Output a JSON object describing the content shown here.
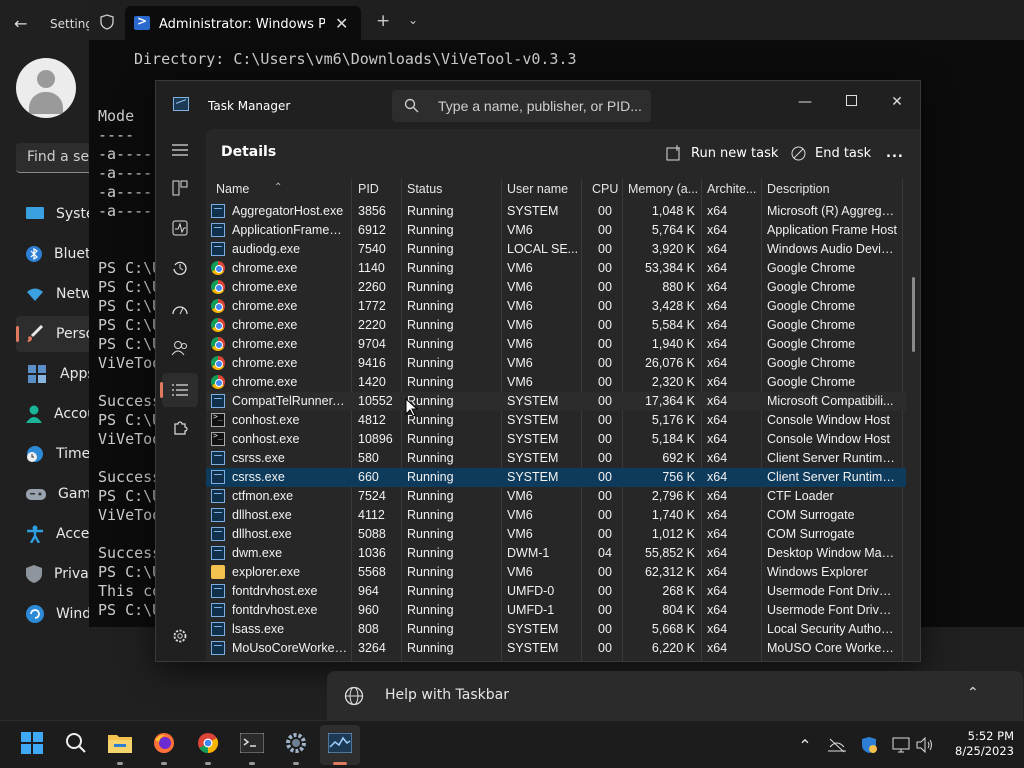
{
  "settings": {
    "title": "Settings",
    "find_placeholder": "Find a setting",
    "nav": [
      {
        "label": "System",
        "icon": "monitor-icon"
      },
      {
        "label": "Bluetooth & devices",
        "icon": "bluetooth-icon"
      },
      {
        "label": "Network & internet",
        "icon": "wifi-icon"
      },
      {
        "label": "Personalization",
        "icon": "brush-icon"
      },
      {
        "label": "Apps",
        "icon": "apps-icon"
      },
      {
        "label": "Accounts",
        "icon": "account-icon"
      },
      {
        "label": "Time & language",
        "icon": "clock-globe-icon"
      },
      {
        "label": "Gaming",
        "icon": "gamepad-icon"
      },
      {
        "label": "Accessibility",
        "icon": "accessibility-icon"
      },
      {
        "label": "Privacy & security",
        "icon": "shield-icon"
      },
      {
        "label": "Windows Update",
        "icon": "update-icon"
      }
    ]
  },
  "terminal": {
    "tab_title": "Administrator: Windows PowerShell",
    "lines": [
      "Directory: C:\\Users\\vm6\\Downloads\\ViVeTool-v0.3.3",
      "Mode",
      "----",
      "-a----",
      "-a----",
      "-a----",
      "-a----",
      "PS C:\\U",
      "PS C:\\U",
      "PS C:\\U",
      "PS C:\\U",
      "PS C:\\U",
      "ViVeToo",
      "Success",
      "PS C:\\U",
      "ViVeToo",
      "Success",
      "PS C:\\U",
      "ViVeToo",
      "Success",
      "PS C:\\U",
      "This co",
      "PS C:\\U"
    ]
  },
  "taskmgr": {
    "title": "Task Manager",
    "search_placeholder": "Type a name, publisher, or PID...",
    "page_title": "Details",
    "run_new_task": "Run new task",
    "end_task": "End task",
    "more": "...",
    "columns": [
      "Name",
      "PID",
      "Status",
      "User name",
      "CPU",
      "Memory (a...",
      "Archite...",
      "Description"
    ],
    "rows": [
      {
        "icon": "exe",
        "name": "AggregatorHost.exe",
        "pid": "3856",
        "status": "Running",
        "user": "SYSTEM",
        "cpu": "00",
        "mem": "1,048 K",
        "arch": "x64",
        "desc": "Microsoft (R) Aggrega..."
      },
      {
        "icon": "exe",
        "name": "ApplicationFrameHo...",
        "pid": "6912",
        "status": "Running",
        "user": "VM6",
        "cpu": "00",
        "mem": "5,764 K",
        "arch": "x64",
        "desc": "Application Frame Host"
      },
      {
        "icon": "exe",
        "name": "audiodg.exe",
        "pid": "7540",
        "status": "Running",
        "user": "LOCAL SE...",
        "cpu": "00",
        "mem": "3,920 K",
        "arch": "x64",
        "desc": "Windows Audio Devic..."
      },
      {
        "icon": "chrome",
        "name": "chrome.exe",
        "pid": "1140",
        "status": "Running",
        "user": "VM6",
        "cpu": "00",
        "mem": "53,384 K",
        "arch": "x64",
        "desc": "Google Chrome"
      },
      {
        "icon": "chrome",
        "name": "chrome.exe",
        "pid": "2260",
        "status": "Running",
        "user": "VM6",
        "cpu": "00",
        "mem": "880 K",
        "arch": "x64",
        "desc": "Google Chrome"
      },
      {
        "icon": "chrome",
        "name": "chrome.exe",
        "pid": "1772",
        "status": "Running",
        "user": "VM6",
        "cpu": "00",
        "mem": "3,428 K",
        "arch": "x64",
        "desc": "Google Chrome"
      },
      {
        "icon": "chrome",
        "name": "chrome.exe",
        "pid": "2220",
        "status": "Running",
        "user": "VM6",
        "cpu": "00",
        "mem": "5,584 K",
        "arch": "x64",
        "desc": "Google Chrome"
      },
      {
        "icon": "chrome",
        "name": "chrome.exe",
        "pid": "9704",
        "status": "Running",
        "user": "VM6",
        "cpu": "00",
        "mem": "1,940 K",
        "arch": "x64",
        "desc": "Google Chrome"
      },
      {
        "icon": "chrome",
        "name": "chrome.exe",
        "pid": "9416",
        "status": "Running",
        "user": "VM6",
        "cpu": "00",
        "mem": "26,076 K",
        "arch": "x64",
        "desc": "Google Chrome"
      },
      {
        "icon": "chrome",
        "name": "chrome.exe",
        "pid": "1420",
        "status": "Running",
        "user": "VM6",
        "cpu": "00",
        "mem": "2,320 K",
        "arch": "x64",
        "desc": "Google Chrome"
      },
      {
        "icon": "exe",
        "name": "CompatTelRunner.exe",
        "pid": "10552",
        "status": "Running",
        "user": "SYSTEM",
        "cpu": "00",
        "mem": "17,364 K",
        "arch": "x64",
        "desc": "Microsoft Compatibili...",
        "state": "hov"
      },
      {
        "icon": "console",
        "name": "conhost.exe",
        "pid": "4812",
        "status": "Running",
        "user": "SYSTEM",
        "cpu": "00",
        "mem": "5,176 K",
        "arch": "x64",
        "desc": "Console Window Host"
      },
      {
        "icon": "console",
        "name": "conhost.exe",
        "pid": "10896",
        "status": "Running",
        "user": "SYSTEM",
        "cpu": "00",
        "mem": "5,184 K",
        "arch": "x64",
        "desc": "Console Window Host"
      },
      {
        "icon": "exe",
        "name": "csrss.exe",
        "pid": "580",
        "status": "Running",
        "user": "SYSTEM",
        "cpu": "00",
        "mem": "692 K",
        "arch": "x64",
        "desc": "Client Server Runtime ..."
      },
      {
        "icon": "exe",
        "name": "csrss.exe",
        "pid": "660",
        "status": "Running",
        "user": "SYSTEM",
        "cpu": "00",
        "mem": "756 K",
        "arch": "x64",
        "desc": "Client Server Runtime ...",
        "state": "sel"
      },
      {
        "icon": "exe",
        "name": "ctfmon.exe",
        "pid": "7524",
        "status": "Running",
        "user": "VM6",
        "cpu": "00",
        "mem": "2,796 K",
        "arch": "x64",
        "desc": "CTF Loader"
      },
      {
        "icon": "exe",
        "name": "dllhost.exe",
        "pid": "4112",
        "status": "Running",
        "user": "VM6",
        "cpu": "00",
        "mem": "1,740 K",
        "arch": "x64",
        "desc": "COM Surrogate"
      },
      {
        "icon": "exe",
        "name": "dllhost.exe",
        "pid": "5088",
        "status": "Running",
        "user": "VM6",
        "cpu": "00",
        "mem": "1,012 K",
        "arch": "x64",
        "desc": "COM Surrogate"
      },
      {
        "icon": "exe",
        "name": "dwm.exe",
        "pid": "1036",
        "status": "Running",
        "user": "DWM-1",
        "cpu": "04",
        "mem": "55,852 K",
        "arch": "x64",
        "desc": "Desktop Window Man..."
      },
      {
        "icon": "folder",
        "name": "explorer.exe",
        "pid": "5568",
        "status": "Running",
        "user": "VM6",
        "cpu": "00",
        "mem": "62,312 K",
        "arch": "x64",
        "desc": "Windows Explorer"
      },
      {
        "icon": "exe",
        "name": "fontdrvhost.exe",
        "pid": "964",
        "status": "Running",
        "user": "UMFD-0",
        "cpu": "00",
        "mem": "268 K",
        "arch": "x64",
        "desc": "Usermode Font Driver ..."
      },
      {
        "icon": "exe",
        "name": "fontdrvhost.exe",
        "pid": "960",
        "status": "Running",
        "user": "UMFD-1",
        "cpu": "00",
        "mem": "804 K",
        "arch": "x64",
        "desc": "Usermode Font Driver ..."
      },
      {
        "icon": "exe",
        "name": "lsass.exe",
        "pid": "808",
        "status": "Running",
        "user": "SYSTEM",
        "cpu": "00",
        "mem": "5,668 K",
        "arch": "x64",
        "desc": "Local Security Authori..."
      },
      {
        "icon": "exe",
        "name": "MoUsoCoreWorker.e...",
        "pid": "3264",
        "status": "Running",
        "user": "SYSTEM",
        "cpu": "00",
        "mem": "6,220 K",
        "arch": "x64",
        "desc": "MoUSO Core Worker ..."
      }
    ]
  },
  "help_flyout": {
    "label": "Help with Taskbar"
  },
  "taskbar": {
    "apps": [
      "start-icon",
      "search-icon",
      "file-explorer-icon",
      "firefox-icon",
      "chrome-icon",
      "terminal-icon",
      "settings-icon",
      "task-manager-icon"
    ],
    "time": "5:52 PM",
    "date": "8/25/2023"
  },
  "colors": {
    "accent": "#e07a5f",
    "selection": "#0e3b5c",
    "window_bg": "#202020"
  }
}
